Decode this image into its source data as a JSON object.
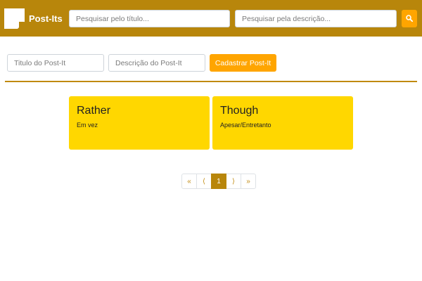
{
  "navbar": {
    "brand_text": "Post-Its",
    "search_title_placeholder": "Pesquisar pelo título...",
    "search_desc_placeholder": "Pesquisar pela descrição...",
    "search_icon": "search-icon"
  },
  "form": {
    "title_placeholder": "Titulo do Post-It",
    "desc_placeholder": "Descrição do Post-It",
    "submit_label": "Cadastrar Post-It"
  },
  "cards": [
    {
      "title": "Rather",
      "description": "Em vez"
    },
    {
      "title": "Though",
      "description": "Apesar/Entretanto"
    }
  ],
  "pagination": {
    "first": "«",
    "prev": "⟨",
    "current": "1",
    "next": "⟩",
    "last": "»"
  },
  "colors": {
    "navbar": "#b8860b",
    "accent": "#ffa500",
    "card": "#ffd700",
    "page_active": "#b8860b"
  }
}
